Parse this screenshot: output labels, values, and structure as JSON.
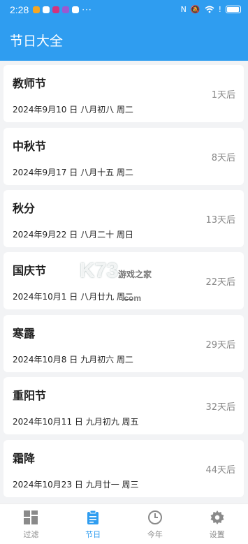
{
  "status": {
    "time": "2:28",
    "dots": "···"
  },
  "header": {
    "title": "节日大全"
  },
  "festivals": [
    {
      "name": "教师节",
      "date": "2024年9月10 日  八月初八 周二",
      "countdown": "1天后"
    },
    {
      "name": "中秋节",
      "date": "2024年9月17 日  八月十五 周二",
      "countdown": "8天后"
    },
    {
      "name": "秋分",
      "date": "2024年9月22 日  八月二十 周日",
      "countdown": "13天后"
    },
    {
      "name": "国庆节",
      "date": "2024年10月1 日  八月廿九 周二",
      "countdown": "22天后"
    },
    {
      "name": "寒露",
      "date": "2024年10月8 日  九月初六 周二",
      "countdown": "29天后"
    },
    {
      "name": "重阳节",
      "date": "2024年10月11 日  九月初九 周五",
      "countdown": "32天后"
    },
    {
      "name": "霜降",
      "date": "2024年10月23 日  九月廿一 周三",
      "countdown": "44天后"
    }
  ],
  "tabs": [
    {
      "label": "过滤",
      "icon": "grid-icon",
      "active": false
    },
    {
      "label": "节日",
      "icon": "clipboard-icon",
      "active": true
    },
    {
      "label": "今年",
      "icon": "clock-icon",
      "active": false
    },
    {
      "label": "设置",
      "icon": "gear-icon",
      "active": false
    }
  ],
  "watermark": {
    "main": "K73",
    "sub": "游戏之家",
    "domain": ".com"
  },
  "colors": {
    "accent": "#2f9df0",
    "background": "#f2f3f5"
  }
}
